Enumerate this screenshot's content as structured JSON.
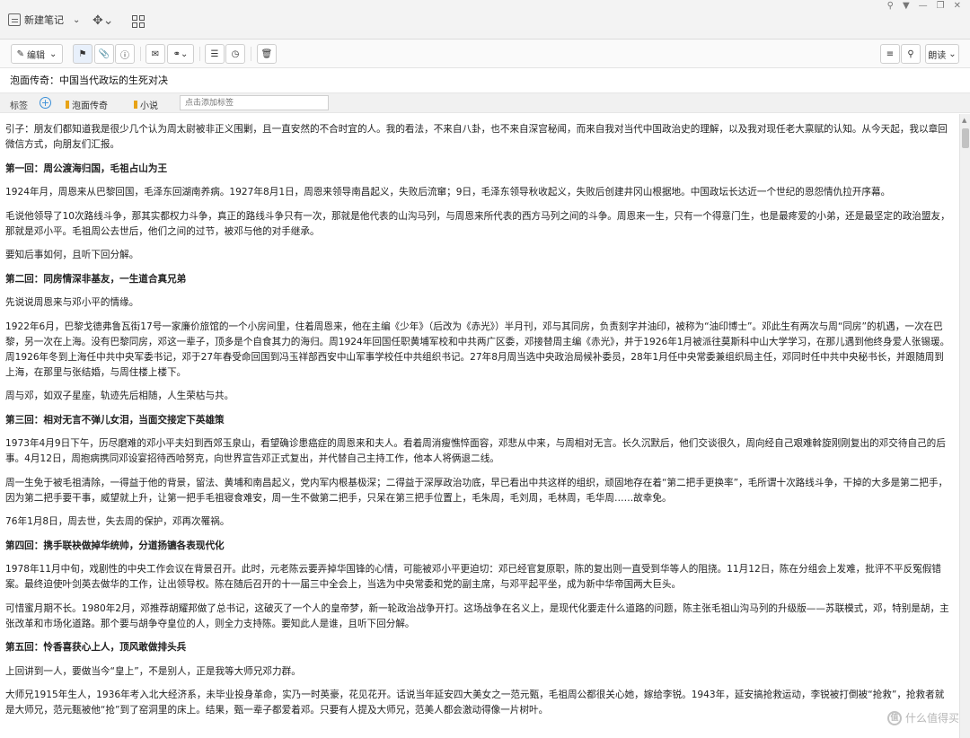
{
  "topbar": {
    "new_note": "新建笔记"
  },
  "toolbar": {
    "edit": "编辑",
    "read_aloud": "朗读"
  },
  "note": {
    "title": "泡面传奇：中国当代政坛的生死对决"
  },
  "tags": {
    "label": "标签",
    "items": [
      "泡面传奇",
      "小说"
    ],
    "placeholder": "点击添加标签"
  },
  "content": [
    {
      "h": false,
      "t": "引子：朋友们都知道我是很少几个认为周太尉被非正义围剿，且一直安然的不合时宜的人。我的看法，不来自八卦，也不来自深宫秘闻，而来自我对当代中国政治史的理解，以及我对现任老大禀赋的认知。从今天起，我以章回微信方式，向朋友们汇报。"
    },
    {
      "h": true,
      "t": "第一回：周公渡海归国，毛祖占山为王"
    },
    {
      "h": false,
      "t": "1924年月，周恩来从巴黎回国，毛泽东回湖南养病。1927年8月1日，周恩来领导南昌起义，失败后流窜；9日，毛泽东领导秋收起义，失败后创建井冈山根据地。中国政坛长达近一个世纪的恩怨情仇拉开序幕。"
    },
    {
      "h": false,
      "t": "毛说他领导了10次路线斗争，那其实都权力斗争，真正的路线斗争只有一次，那就是他代表的山沟马列，与周恩来所代表的西方马列之间的斗争。周恩来一生，只有一个得意门生，也是最疼爱的小弟，还是最坚定的政治盟友，那就是邓小平。毛祖周公去世后，他们之间的过节，被邓与他的对手继承。"
    },
    {
      "h": false,
      "t": "要知后事如何，且听下回分解。"
    },
    {
      "h": true,
      "t": "第二回：同房情深非基友，一生道合真兄弟"
    },
    {
      "h": false,
      "t": "先说说周恩来与邓小平的情缘。"
    },
    {
      "h": false,
      "t": "1922年6月，巴黎戈德弗鲁瓦街17号一家廉价旅馆的一个小房间里，住着周恩来，他在主编《少年》（后改为《赤光》）半月刊，邓与其同房，负责刻字并油印，被称为“油印博士”。邓此生有两次与周“同房”的机遇，一次在巴黎，另一次在上海。没有巴黎同房，邓这一辈子，顶多是个自食其力的海归。周1924年回国任职黄埔军校和中共两广区委，邓接替周主编《赤光》，并于1926年1月被派往莫斯科中山大学学习，在那儿遇到他终身爱人张锡瑗。周1926年冬到上海任中共中央军委书记，邓于27年春受命回国到冯玉祥部西安中山军事学校任中共组织书记。27年8月周当选中央政治局候补委员，28年1月任中央常委兼组织局主任，邓同时任中共中央秘书长，并跟随周到上海，在那里与张结婚，与周住楼上楼下。"
    },
    {
      "h": false,
      "t": "周与邓，如双子星座，轨迹先后相随，人生荣枯与共。"
    },
    {
      "h": true,
      "t": "第三回：相对无言不弹儿女泪，当面交接定下英雄策"
    },
    {
      "h": false,
      "t": "1973年4月9日下午，历尽磨难的邓小平夫妇到西郊玉泉山，看望确诊患癌症的周恩来和夫人。看着周消瘦憔悴面容，邓悲从中来，与周相对无言。长久沉默后，他们交谈很久，周向经自己艰难斡旋刚刚复出的邓交待自己的后事。4月12日，周抱病携同邓设宴招待西哈努克，向世界宣告邓正式复出，并代替自己主持工作，他本人将俩退二线。"
    },
    {
      "h": false,
      "t": "周一生免于被毛祖清除，一得益于他的背景，留法、黄埔和南昌起义，党内军内根基极深；二得益于深厚政治功底，早已看出中共这样的组织，顽固地存在着“第二把手更换率”，毛所谓十次路线斗争，干掉的大多是第二把手，因为第二把手要干事，威望就上升，让第一把手毛祖寝食难安，周一生不做第二把手，只呆在第三把手位置上，毛朱周，毛刘周，毛林周，毛华周……故幸免。"
    },
    {
      "h": false,
      "t": "76年1月8日，周去世，失去周的保护，邓再次罹祸。"
    },
    {
      "h": true,
      "t": "第四回：携手联袂做掉华统帅，分道扬镳各表现代化"
    },
    {
      "h": false,
      "t": "1978年11月中旬，戏剧性的中央工作会议在背景召开。此时，元老陈云要弄掉华国锋的心情，可能被邓小平更迫切：邓已经官复原职，陈的复出则一直受到华等人的阻挠。11月12日，陈在分组会上发难，批评不平反冤假错案。最终迫使叶剑英去做华的工作，让出领导权。陈在随后召开的十一届三中全会上，当选为中央常委和党的副主席，与邓平起平坐，成为新中华帝国两大巨头。"
    },
    {
      "h": false,
      "t": "可惜蜜月期不长。1980年2月，邓推荐胡耀邦做了总书记，这破灭了一个人的皇帝梦，新一轮政治战争开打。这场战争在名义上，是现代化要走什么道路的问题，陈主张毛祖山沟马列的升级版——苏联模式，邓，特别是胡，主张改革和市场化道路。那个要与胡争夺皇位的人，则全力支持陈。要知此人是谁，且听下回分解。"
    },
    {
      "h": true,
      "t": "第五回：怜香喜获心上人，顶风敢做排头兵"
    },
    {
      "h": false,
      "t": "上回讲到一人，要做当今“皇上”，不是别人，正是我等大师兄邓力群。"
    },
    {
      "h": false,
      "t": "大师兄1915年生人，1936年考入北大经济系，未毕业投身革命，实乃一时英豪，花见花开。话说当年延安四大美女之一范元甄，毛祖周公都很关心她，嫁给李锐。1943年，延安搞抢救运动，李锐被打倒被“抢救”，抢救者就是大师兄，范元甄被他“抢”到了窑洞里的床上。结果，甄一辈子都爱着邓。只要有人提及大师兄，范美人都会激动得像一片树叶。"
    }
  ],
  "watermark": "什么值得买"
}
